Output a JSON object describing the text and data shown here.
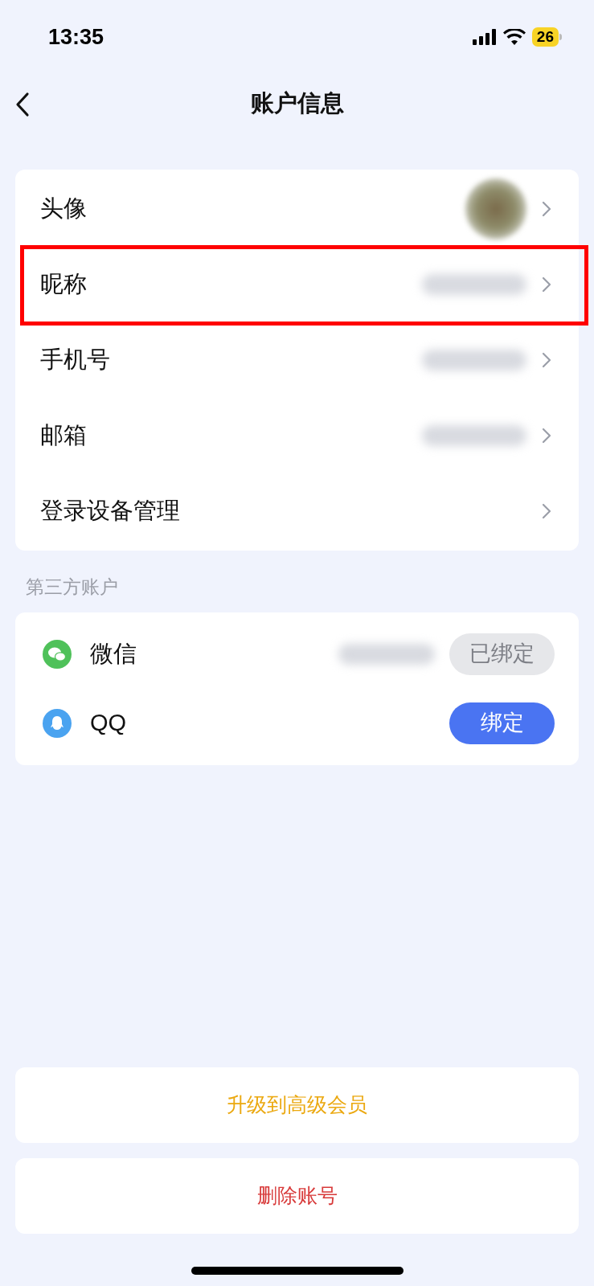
{
  "status_bar": {
    "time": "13:35",
    "battery": "26"
  },
  "nav": {
    "title": "账户信息"
  },
  "account_rows": [
    {
      "label": "头像",
      "kind": "avatar",
      "highlighted": false
    },
    {
      "label": "昵称",
      "kind": "blurred",
      "highlighted": true
    },
    {
      "label": "手机号",
      "kind": "blurred",
      "highlighted": false
    },
    {
      "label": "邮箱",
      "kind": "blurred",
      "highlighted": false
    },
    {
      "label": "登录设备管理",
      "kind": "plain",
      "highlighted": false
    }
  ],
  "third_party": {
    "label": "第三方账户",
    "items": [
      {
        "name": "微信",
        "kind": "wechat",
        "bound": true,
        "button": "已绑定"
      },
      {
        "name": "QQ",
        "kind": "qq",
        "bound": false,
        "button": "绑定"
      }
    ]
  },
  "actions": [
    {
      "label": "升级到高级会员",
      "kind": "upgrade"
    },
    {
      "label": "删除账号",
      "kind": "delete"
    }
  ]
}
